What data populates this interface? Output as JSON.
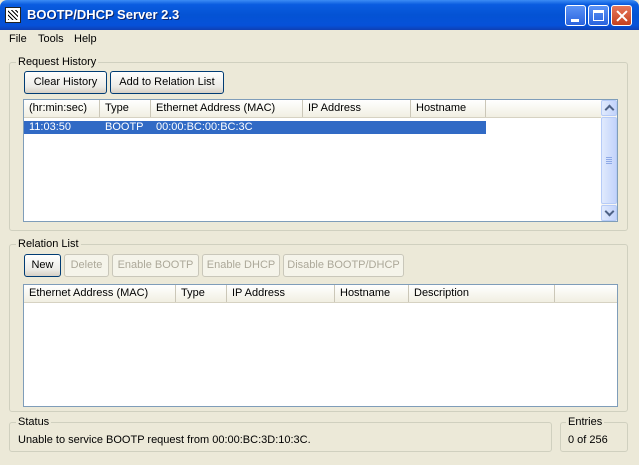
{
  "window": {
    "title": "BOOTP/DHCP Server 2.3"
  },
  "menu": [
    "File",
    "Tools",
    "Help"
  ],
  "request_history": {
    "label": "Request History",
    "buttons": {
      "clear_history": "Clear History",
      "add_to_relation": "Add to Relation List"
    },
    "columns": [
      "(hr:min:sec)",
      "Type",
      "Ethernet Address (MAC)",
      "IP Address",
      "Hostname"
    ],
    "rows": [
      {
        "time": "11:03:50",
        "type": "BOOTP",
        "mac": "00:00:BC:00:BC:3C",
        "ip": "",
        "hostname": "",
        "selected": true
      }
    ]
  },
  "relation_list": {
    "label": "Relation List",
    "buttons": {
      "new": "New",
      "delete": "Delete",
      "enable_bootp": "Enable BOOTP",
      "enable_dhcp": "Enable DHCP",
      "disable_bootp_dhcp": "Disable BOOTP/DHCP"
    },
    "columns": [
      "Ethernet Address (MAC)",
      "Type",
      "IP Address",
      "Hostname",
      "Description"
    ]
  },
  "status": {
    "label": "Status",
    "text": "Unable to service BOOTP request from 00:00:BC:3D:10:3C."
  },
  "entries": {
    "label": "Entries",
    "text": "0 of 256"
  },
  "colors": {
    "selection": "#316AC5",
    "titlebar": "#0A5CE0",
    "face": "#ECE9D8"
  }
}
